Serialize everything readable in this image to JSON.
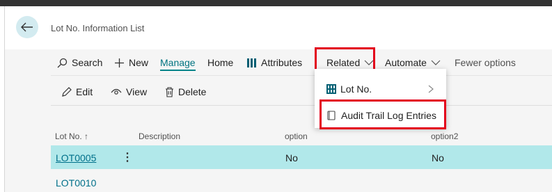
{
  "page": {
    "title": "Lot No. Information List"
  },
  "actions": {
    "search": "Search",
    "new": "New",
    "manage": "Manage",
    "home": "Home",
    "attributes": "Attributes",
    "related": "Related",
    "automate": "Automate",
    "fewer_options": "Fewer options"
  },
  "subactions": {
    "edit": "Edit",
    "view": "View",
    "delete": "Delete"
  },
  "related_menu": {
    "items": [
      {
        "label": "Lot No.",
        "icon": "grid-icon",
        "has_submenu": true
      },
      {
        "label": "Audit Trail Log Entries",
        "icon": "document-icon",
        "has_submenu": false
      }
    ]
  },
  "table": {
    "columns": [
      "Lot No. ↑",
      "Description",
      "option",
      "option2"
    ],
    "rows": [
      {
        "lot_no": "LOT0005",
        "description": "",
        "option": "No",
        "option2": "No",
        "selected": true
      },
      {
        "lot_no": "LOT0010",
        "description": "",
        "option": "",
        "option2": "",
        "selected": false
      }
    ]
  },
  "colors": {
    "accent": "#008489",
    "highlight": "#e3001b",
    "selected_row": "#b1e8ea"
  }
}
